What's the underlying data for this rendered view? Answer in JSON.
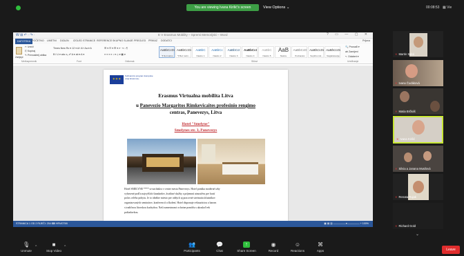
{
  "topbar": {
    "share_banner": "You are viewing Ivana Kirilić's screen",
    "view_options": "View Options ⌄",
    "time": "00:08:53",
    "layout": "▦ Vie"
  },
  "word": {
    "qat": "W  ⊞  ↶ · ↷ ·",
    "window_title": "E V Erasmus Mobility – Spremi Memorijski – Word",
    "window_controls": "?  ▭  —  ▢  ✕",
    "tabs": [
      "DATOTEKA",
      "POČETNO",
      "UMETNI",
      "DIZAJN",
      "IZGLED STRANICE",
      "REFERENCE",
      "SKUPNO SLANJE",
      "PREGLED",
      "PRIKAZ",
      "DODATCI"
    ],
    "user": "Prijava",
    "ribbon": {
      "paste": "Zalijepi",
      "clipboard_items": [
        "✂ Izreži",
        "⎘ Kopiraj",
        "✎ Prenositelj oblika"
      ],
      "font_row1": "Times New Ro ▾  12 ▾  A˄ A˅  Aa ▾  A",
      "font_row2": "B  I  U ▾ abc  x₂  x²  A ▾  ab ▾  A ▾",
      "para_row1": "☰ ▾  ☷ ▾  ☰ ▾  ⇤  ⇥  ↕  ¶",
      "para_row2": "≡  ≡  ≡  ≡  ↕ ▾  ◇ ▾  ▦ ▾",
      "groups": [
        "Međuspremnik",
        "Font",
        "Odlomak",
        "Stilovi",
        "Uređivanje"
      ],
      "styles": [
        {
          "sample": "AaBbCcDc",
          "name": "¶ Normalno"
        },
        {
          "sample": "AaBbCcDc",
          "name": "¶ Bez razm..."
        },
        {
          "sample": "AaBbC",
          "name": "Naslov 1"
        },
        {
          "sample": "AaBbCc",
          "name": "Naslov 2"
        },
        {
          "sample": "AaBbCcI",
          "name": "Naslov 3"
        },
        {
          "sample": "AaBbCcI",
          "name": "Naslov 4"
        },
        {
          "sample": "AaBbC",
          "name": "Naslov 5"
        },
        {
          "sample": "AaBbCcI",
          "name": "Naslov 6"
        },
        {
          "sample": "AaB",
          "name": "Naslov"
        },
        {
          "sample": "AaBbCcD",
          "name": "Podnaslov"
        },
        {
          "sample": "AaBbCcDc",
          "name": "Suptilno isti..."
        },
        {
          "sample": "AaBbCcDc",
          "name": "Naglašavanje"
        }
      ],
      "editing": [
        "🔍 Pronađi ▾",
        "ab Zamijeni",
        "↖ Odaberi ▾"
      ]
    },
    "document": {
      "eu_text": "Sufinancira program Europske unije Erasmus+",
      "title": "Erasmus Virtualna mobilita Litva",
      "line2_prefix": "u ",
      "line2_link": "Panevezio Margaritos Rimkevicaites profesinio rengimo",
      "line3": "centras, Panevezys, Litva",
      "hotel_label": "Hotel \"Smelyne\"",
      "hotel_address": "Smelynes str. 3, Panevezys",
      "body_lines": [
        "Hotel SMELYNE **** se nachádza v centre mesta Panevezys. Hotel ponúka moderné izby",
        "vybavené podľa najvyšších štandardov, kvalitné služby a príjemnú atmosféru pre hostí",
        "počas celého pobytu. Je to ideálne miesto pre oddych aj pracovné stretnutia účastníkov",
        "organizovaných seminárov, konferencií a školení. Hotel disponuje reštauráciou a barom",
        "s tradičnou litovskou kuchyňou. Naši zamestnanci ochotne pomôžu s akoukoľvek",
        "požiadavkou."
      ]
    },
    "status_left": "STRANICA 1 OD 2   RIJEČI: 254   ⌨   HRVATSKI",
    "status_right": "▦  ▤  ▥   —————●—————  +  100%"
  },
  "participants": [
    {
      "name": "Martin Sabó",
      "muted": true
    },
    {
      "name": "Ivana Čudáková",
      "muted": true
    },
    {
      "name": "Matia Brčkáš",
      "muted": true
    },
    {
      "name": "Ivana Kirilić",
      "muted": true,
      "active": true
    },
    {
      "name": "Silvia a Janana Musilová",
      "muted": true
    },
    {
      "name": "Renata Rujak",
      "muted": true
    },
    {
      "name": "Richard Gold",
      "muted": true
    }
  ],
  "toolbar": {
    "unmute": "Unmute",
    "stop_video": "Stop Video",
    "participants": "Participants",
    "participants_count": "6",
    "chat": "Chat",
    "share_screen": "Share Screen",
    "record": "Record",
    "reactions": "Reactions",
    "apps": "Apps",
    "leave": "Leave"
  },
  "colors": {
    "zoom_green": "#2fbe3c",
    "word_blue": "#2b579a",
    "active_speaker": "#c7e634",
    "leave_red": "#e02d2d",
    "link_red": "#c0282d"
  }
}
